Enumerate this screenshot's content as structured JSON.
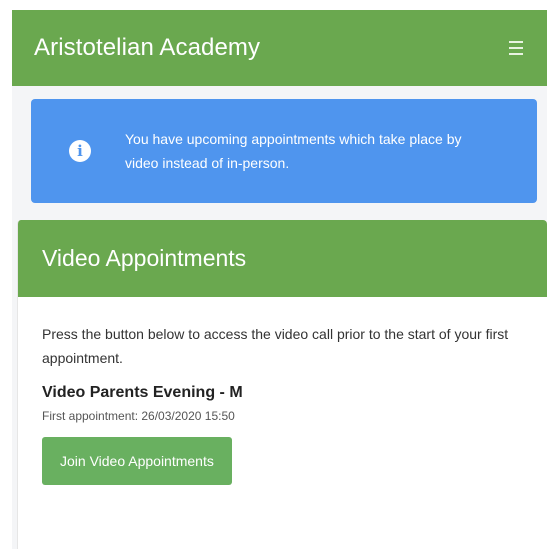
{
  "app": {
    "title": "Aristotelian Academy",
    "menu_icon": "hamburger-menu-icon"
  },
  "alert": {
    "icon": "info-icon",
    "icon_glyph": "i",
    "message": "You have upcoming appointments which take place by video instead of in-person."
  },
  "video_card": {
    "title": "Video Appointments",
    "description": "Press the button below to access the video call prior to the start of your first appointment.",
    "event_name": "Video Parents Evening - M",
    "first_appointment": "First appointment: 26/03/2020 15:50",
    "join_button_label": "Join Video Appointments"
  },
  "colors": {
    "brand_green": "#6aa84f",
    "alert_blue": "#4f95ee",
    "button_green": "#69b060"
  }
}
